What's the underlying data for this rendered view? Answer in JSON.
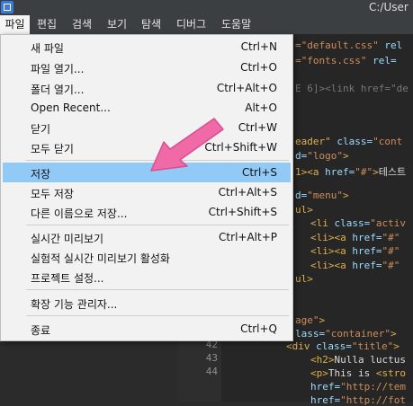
{
  "window": {
    "title": "C:/User"
  },
  "menubar": {
    "items": [
      {
        "label": "파일",
        "active": true
      },
      {
        "label": "편집"
      },
      {
        "label": "검색"
      },
      {
        "label": "보기"
      },
      {
        "label": "탐색"
      },
      {
        "label": "디버그"
      },
      {
        "label": "도움말"
      }
    ]
  },
  "file_menu": {
    "items": [
      {
        "label": "새 파일",
        "shortcut": "Ctrl+N"
      },
      {
        "label": "파일 열기...",
        "shortcut": "Ctrl+O"
      },
      {
        "label": "폴더 열기...",
        "shortcut": "Ctrl+Alt+O"
      },
      {
        "label": "Open Recent...",
        "shortcut": "Alt+O"
      },
      {
        "label": "닫기",
        "shortcut": "Ctrl+W"
      },
      {
        "label": "모두 닫기",
        "shortcut": "Ctrl+Shift+W"
      },
      {
        "label": "저장",
        "shortcut": "Ctrl+S",
        "highlighted": true
      },
      {
        "label": "모두 저장",
        "shortcut": "Ctrl+Alt+S"
      },
      {
        "label": "다른 이름으로 저장...",
        "shortcut": "Ctrl+Shift+S"
      },
      {
        "label": "실시간 미리보기",
        "shortcut": "Ctrl+Alt+P"
      },
      {
        "label": "실험적 실시간 미리보기 활성화",
        "shortcut": ""
      },
      {
        "label": "프로젝트 설정...",
        "shortcut": ""
      },
      {
        "label": "확장 기능 관리자...",
        "shortcut": ""
      },
      {
        "label": "종료",
        "shortcut": "Ctrl+Q"
      }
    ]
  },
  "editor": {
    "line_numbers": [
      "42",
      "43",
      "44"
    ],
    "lines": [
      {
        "parts": [
          [
            "c-str",
            "=\"default.css\""
          ],
          [
            "c-txt",
            " "
          ],
          [
            "c-attr",
            "rel"
          ]
        ]
      },
      {
        "parts": [
          [
            "c-str",
            "=\"fonts.css\""
          ],
          [
            "c-txt",
            " "
          ],
          [
            "c-attr",
            "rel="
          ]
        ]
      },
      {
        "parts": [
          [
            "c-dim",
            "E 6]><link href=\"de"
          ]
        ]
      },
      {
        "parts": [
          [
            "c-tag",
            "eader\""
          ],
          [
            "c-txt",
            " "
          ],
          [
            "c-attr",
            "class="
          ],
          [
            "c-str",
            "\"cont"
          ]
        ]
      },
      {
        "parts": [
          [
            "c-attr",
            "d="
          ],
          [
            "c-str",
            "\"logo\""
          ],
          [
            "c-tag",
            ">"
          ]
        ]
      },
      {
        "parts": [
          [
            "c-tag",
            "1><a "
          ],
          [
            "c-attr",
            "href="
          ],
          [
            "c-str",
            "\"#\""
          ],
          [
            "c-tag",
            ">"
          ],
          [
            "c-txt",
            "테스트"
          ]
        ]
      },
      {
        "parts": [
          [
            "c-attr",
            "d="
          ],
          [
            "c-str",
            "\"menu\""
          ],
          [
            "c-tag",
            ">"
          ]
        ]
      },
      {
        "parts": [
          [
            "c-tag",
            "ul>"
          ]
        ]
      },
      {
        "parts": [
          [
            "c-tag",
            "<li "
          ],
          [
            "c-attr",
            "class="
          ],
          [
            "c-str",
            "\"activ"
          ]
        ]
      },
      {
        "parts": [
          [
            "c-tag",
            "<li><a "
          ],
          [
            "c-attr",
            "href="
          ],
          [
            "c-str",
            "\"#\""
          ]
        ]
      },
      {
        "parts": [
          [
            "c-tag",
            "<li><a "
          ],
          [
            "c-attr",
            "href="
          ],
          [
            "c-str",
            "\"#\""
          ]
        ]
      },
      {
        "parts": [
          [
            "c-tag",
            "<li><a "
          ],
          [
            "c-attr",
            "href="
          ],
          [
            "c-str",
            "\"#\""
          ]
        ]
      },
      {
        "parts": [
          [
            "c-tag",
            "ul>"
          ]
        ]
      },
      {
        "parts": [
          [
            "c-str",
            "age\""
          ],
          [
            "c-tag",
            ">"
          ]
        ]
      },
      {
        "parts": [
          [
            "c-attr",
            "lass="
          ],
          [
            "c-str",
            "\"container\""
          ],
          [
            "c-tag",
            ">"
          ]
        ]
      },
      {
        "parts": [
          [
            "c-tag",
            "<div "
          ],
          [
            "c-attr",
            "class="
          ],
          [
            "c-str",
            "\"title\""
          ],
          [
            "c-tag",
            ">"
          ]
        ]
      },
      {
        "parts": [
          [
            "c-tag",
            "<h2>"
          ],
          [
            "c-txt",
            "Nulla luctus"
          ]
        ]
      },
      {
        "parts": [
          [
            "c-tag",
            "<p>"
          ],
          [
            "c-txt",
            "This is "
          ],
          [
            "c-tag",
            "<stro"
          ]
        ]
      },
      {
        "parts": [
          [
            "c-attr",
            "href="
          ],
          [
            "c-str",
            "\"http://tem"
          ]
        ]
      },
      {
        "parts": [
          [
            "c-attr",
            "href="
          ],
          [
            "c-str",
            "\"http://fot"
          ]
        ]
      }
    ]
  }
}
